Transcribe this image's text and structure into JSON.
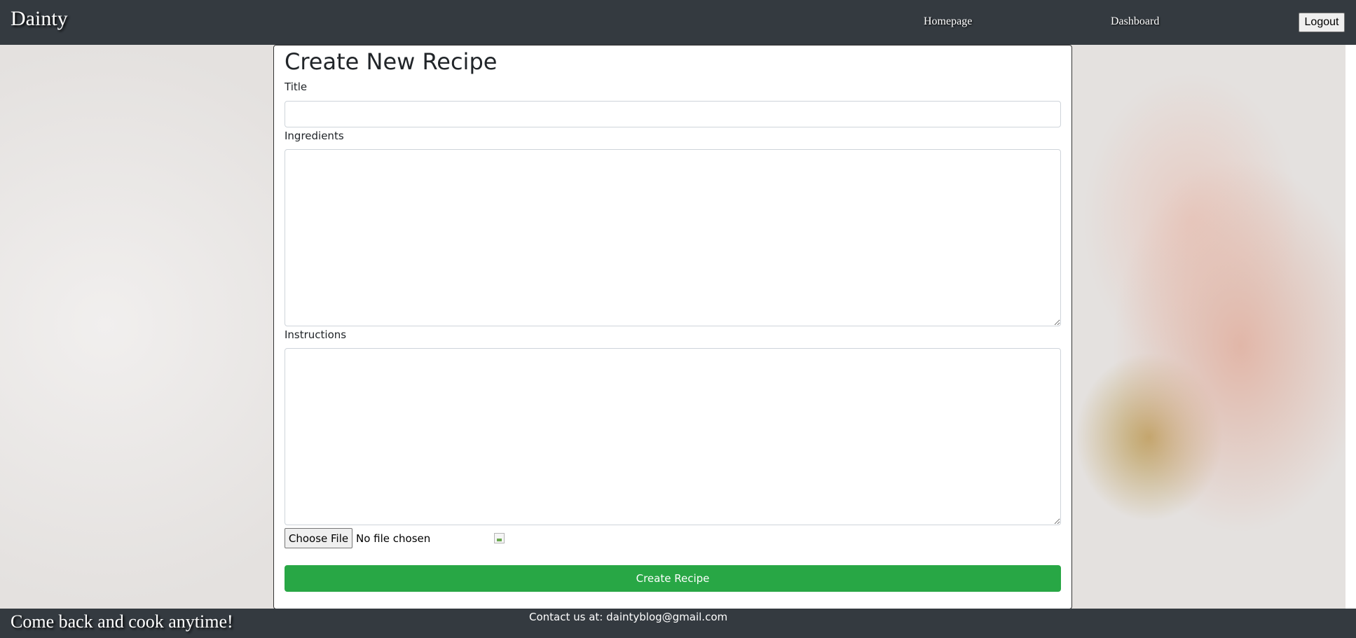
{
  "navbar": {
    "brand": "Dainty",
    "links": [
      "Homepage",
      "Dashboard"
    ],
    "logout_label": "Logout"
  },
  "form": {
    "heading": "Create New Recipe",
    "title_label": "Title",
    "title_value": "",
    "ingredients_label": "Ingredients",
    "ingredients_value": "",
    "instructions_label": "Instructions",
    "instructions_value": "",
    "file_button_label": "Choose File",
    "file_status": "No file chosen",
    "submit_label": "Create Recipe"
  },
  "footer": {
    "tagline": "Come back and cook anytime!",
    "contact": "Contact us at: daintyblog@gmail.com"
  },
  "colors": {
    "navbar": "#343a40",
    "submit": "#28a745"
  }
}
